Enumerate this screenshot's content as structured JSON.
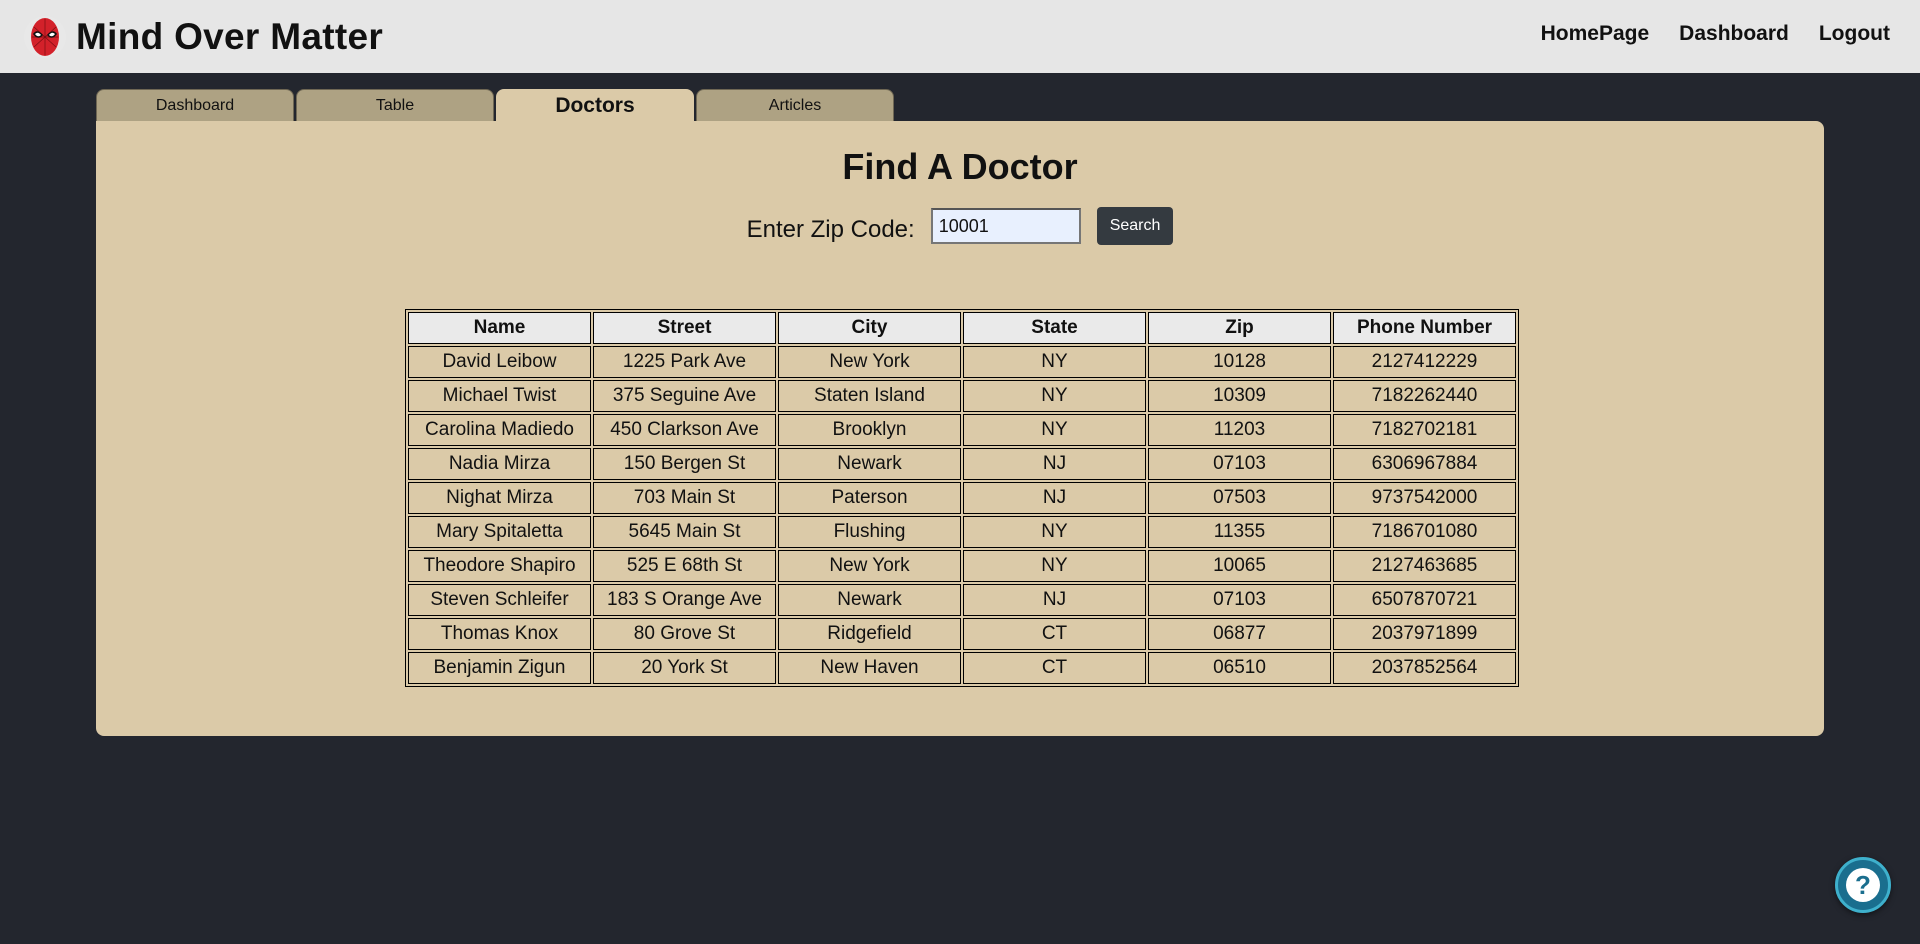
{
  "header": {
    "title": "Mind Over Matter",
    "logo_icon": "spiderman-mask-icon",
    "nav": [
      {
        "label": "HomePage"
      },
      {
        "label": "Dashboard"
      },
      {
        "label": "Logout"
      }
    ]
  },
  "tabs": [
    {
      "label": "Dashboard",
      "active": false
    },
    {
      "label": "Table",
      "active": false
    },
    {
      "label": "Doctors",
      "active": true
    },
    {
      "label": "Articles",
      "active": false
    }
  ],
  "main": {
    "title": "Find A Doctor",
    "zip_label": "Enter Zip Code:",
    "zip_value": "10001",
    "search_label": "Search"
  },
  "table": {
    "columns": [
      "Name",
      "Street",
      "City",
      "State",
      "Zip",
      "Phone Number"
    ],
    "rows": [
      [
        "David Leibow",
        "1225 Park Ave",
        "New York",
        "NY",
        "10128",
        "2127412229"
      ],
      [
        "Michael Twist",
        "375 Seguine Ave",
        "Staten Island",
        "NY",
        "10309",
        "7182262440"
      ],
      [
        "Carolina Madiedo",
        "450 Clarkson Ave",
        "Brooklyn",
        "NY",
        "11203",
        "7182702181"
      ],
      [
        "Nadia Mirza",
        "150 Bergen St",
        "Newark",
        "NJ",
        "07103",
        "6306967884"
      ],
      [
        "Nighat Mirza",
        "703 Main St",
        "Paterson",
        "NJ",
        "07503",
        "9737542000"
      ],
      [
        "Mary Spitaletta",
        "5645 Main St",
        "Flushing",
        "NY",
        "11355",
        "7186701080"
      ],
      [
        "Theodore Shapiro",
        "525 E 68th St",
        "New York",
        "NY",
        "10065",
        "2127463685"
      ],
      [
        "Steven Schleifer",
        "183 S Orange Ave",
        "Newark",
        "NJ",
        "07103",
        "6507870721"
      ],
      [
        "Thomas Knox",
        "80 Grove St",
        "Ridgefield",
        "CT",
        "06877",
        "2037971899"
      ],
      [
        "Benjamin Zigun",
        "20 York St",
        "New Haven",
        "CT",
        "06510",
        "2037852564"
      ]
    ]
  },
  "help": {
    "icon": "question-mark-icon",
    "glyph": "?"
  }
}
